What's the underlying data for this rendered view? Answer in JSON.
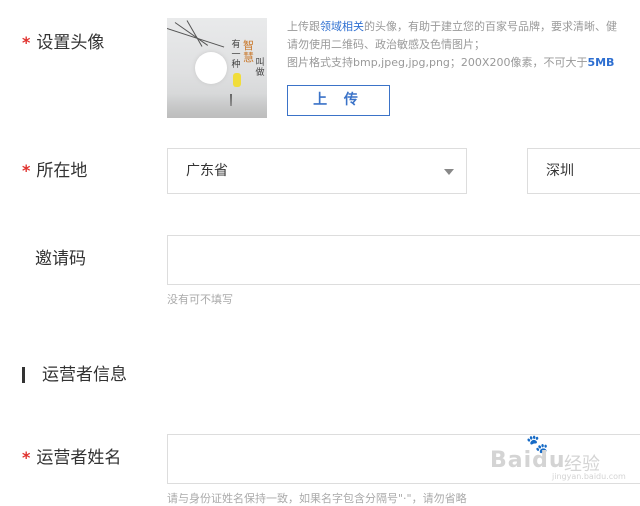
{
  "avatar": {
    "label": "设置头像",
    "art_text": [
      "有一种",
      "智慧",
      "叫做"
    ],
    "tip_line1_prefix": "上传跟",
    "tip_line1_link": "领域相关",
    "tip_line1_suffix": "的头像，有助于建立您的百家号品牌，要求清晰、健",
    "tip_line2": "请勿使用二维码、政治敏感及色情图片；",
    "tip_line3_prefix": "图片格式支持bmp,jpeg,jpg,png；200X200像素，不可大于",
    "tip_line3_size": "5MB",
    "upload_button": "上 传"
  },
  "location": {
    "label": "所在地",
    "province": "广东省",
    "city": "深圳"
  },
  "invite": {
    "label": "邀请码",
    "value": "",
    "hint": "没有可不填写"
  },
  "operator_section": {
    "title": "运营者信息"
  },
  "operator_name": {
    "label": "运营者姓名",
    "value": "",
    "hint": "请与身份证姓名保持一致，如果名字包含分隔号\"·\"，请勿省略"
  },
  "watermark": {
    "brand": "Baidu",
    "cn": "经验",
    "url": "jingyan.baidu.com"
  },
  "colors": {
    "required_mark": "#e0302c",
    "link": "#2e6fd1",
    "button_border": "#3b73c8"
  }
}
